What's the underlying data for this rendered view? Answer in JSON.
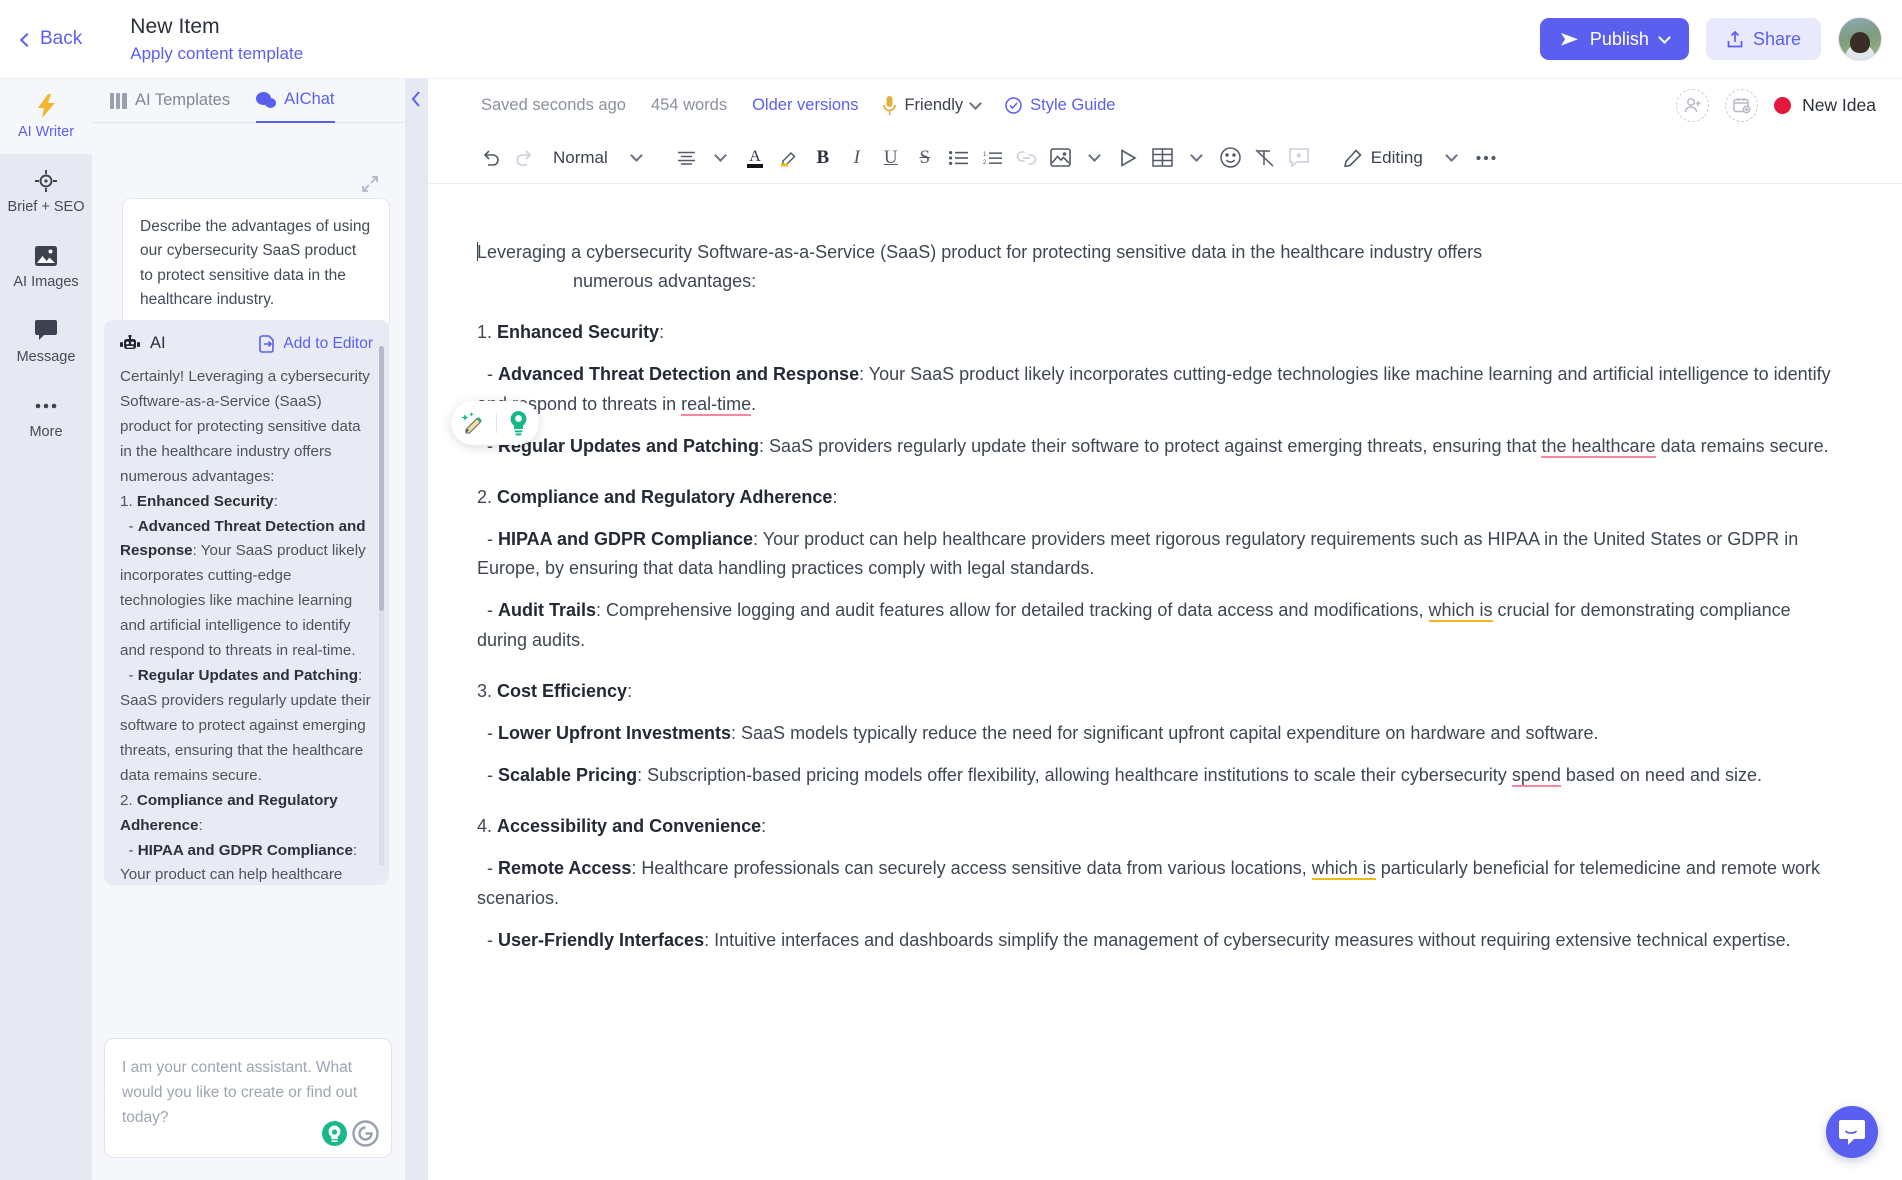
{
  "topbar": {
    "back_label": "Back",
    "doc_title": "New Item",
    "doc_subtitle": "Apply content template",
    "publish_label": "Publish",
    "share_label": "Share"
  },
  "rail": {
    "items": [
      {
        "label": "AI Writer",
        "icon": "lightning-icon",
        "active": true
      },
      {
        "label": "Brief + SEO",
        "icon": "target-icon",
        "active": false
      },
      {
        "label": "AI Images",
        "icon": "image-icon",
        "active": false
      },
      {
        "label": "Message",
        "icon": "chat-icon",
        "active": false
      },
      {
        "label": "More",
        "icon": "ellipsis-icon",
        "active": false
      }
    ]
  },
  "chat": {
    "tabs": [
      {
        "label": "AI Templates",
        "icon": "templates-icon",
        "active": false
      },
      {
        "label": "AIChat",
        "icon": "chat-bubbles-icon",
        "active": true
      }
    ],
    "user_message": "Describe the advantages of using our cybersecurity SaaS product to protect sensitive data in the healthcare industry.",
    "ai_label": "AI",
    "add_to_editor_label": "Add to Editor",
    "ai_response_intro": "Certainly! Leveraging a cybersecurity Software-as-a-Service (SaaS) product for protecting sensitive data in the healthcare industry offers numerous advantages:",
    "ai_response_items": [
      {
        "num": "1. ",
        "heading": "Enhanced Security",
        "tail": ":"
      },
      {
        "dash": "  - ",
        "heading": "Advanced Threat Detection and Response",
        "tail": ": Your SaaS product likely incorporates cutting-edge technologies like machine learning and artificial intelligence to identify and respond to threats in real-time."
      },
      {
        "dash": "  - ",
        "heading": "Regular Updates and Patching",
        "tail": ": SaaS providers regularly update their software to protect against emerging threats, ensuring that the healthcare data remains secure."
      },
      {
        "num": "2. ",
        "heading": "Compliance and Regulatory Adherence",
        "tail": ":"
      },
      {
        "dash": "  - ",
        "heading": "HIPAA and GDPR Compliance",
        "tail": ": Your product can help healthcare providers meet rigorous regulatory requirements such as HIPAA in the United States or GDPR in Europe, by ensuring that data handling practices comply with legal standards."
      }
    ],
    "input_placeholder": "I am your content assistant. What would you like to create or find out today?"
  },
  "editor": {
    "status": {
      "saved": "Saved seconds ago",
      "word_count": "454 words",
      "older_versions": "Older versions",
      "tone": "Friendly",
      "style_guide": "Style Guide",
      "idea_label": "New Idea",
      "idea_color": "#e2183f"
    },
    "toolbar": {
      "undo": "undo-icon",
      "redo": "redo-icon",
      "paragraph_style": "Normal",
      "align": "align-icon",
      "font_color": "font-color-icon",
      "highlight": "highlight-icon",
      "bold": "B",
      "italic": "I",
      "underline": "U",
      "strikethrough": "S",
      "bullet_list": "bullet-list-icon",
      "numbered_list": "numbered-list-icon",
      "link": "link-icon",
      "image": "image-icon",
      "video": "video-icon",
      "table": "table-icon",
      "emoji": "emoji-icon",
      "clear_format": "clear-format-icon",
      "comment": "comment-icon",
      "mode": "Editing",
      "more": "ellipsis-icon"
    },
    "document": {
      "intro_a": "Leveraging a cybersecurity Software-as-a-Service (SaaS) product for protecting sensitive data in the healthcare industry offers",
      "intro_b": "numerous advantages:",
      "sections": [
        {
          "num": "1. ",
          "title": "Enhanced Security",
          "bullets": [
            {
              "label": "Advanced Threat Detection and Response",
              "text_a": ": Your SaaS product likely incorporates cutting-edge technologies like machine learning and artificial intelligence to identify and respond to threats in ",
              "flag": "real-time",
              "flag_type": "red",
              "text_b": "."
            },
            {
              "label": "Regular Updates and Patching",
              "text_a": ": SaaS providers regularly update their software to protect against emerging threats, ensuring that ",
              "flag": "the healthcare",
              "flag_type": "red",
              "text_b": " data remains secure."
            }
          ]
        },
        {
          "num": "2. ",
          "title": "Compliance and Regulatory Adherence",
          "bullets": [
            {
              "label": "HIPAA and GDPR Compliance",
              "text_a": ": Your product can help healthcare providers meet rigorous regulatory requirements such as HIPAA in the United States or GDPR in Europe, by ensuring that data handling practices comply with legal standards.",
              "flag": "",
              "flag_type": "none",
              "text_b": ""
            },
            {
              "label": "Audit Trails",
              "text_a": ": Comprehensive logging and audit features allow for detailed tracking of data access and modifications, ",
              "flag": "which is",
              "flag_type": "yellow",
              "text_b": " crucial for demonstrating compliance during audits."
            }
          ]
        },
        {
          "num": "3. ",
          "title": "Cost Efficiency",
          "bullets": [
            {
              "label": "Lower Upfront Investments",
              "text_a": ": SaaS models typically reduce the need for significant upfront capital expenditure on hardware and software.",
              "flag": "",
              "flag_type": "none",
              "text_b": ""
            },
            {
              "label": "Scalable Pricing",
              "text_a": ": Subscription-based pricing models offer flexibility, allowing healthcare institutions to scale their cybersecurity ",
              "flag": "spend",
              "flag_type": "red",
              "text_b": " based on need and size."
            }
          ]
        },
        {
          "num": "4. ",
          "title": "Accessibility and Convenience",
          "bullets": [
            {
              "label": "Remote Access",
              "text_a": ": Healthcare professionals can securely access sensitive data from various locations, ",
              "flag": "which is",
              "flag_type": "yellow",
              "text_b": " particularly beneficial for telemedicine and remote work scenarios."
            },
            {
              "label": "User-Friendly Interfaces",
              "text_a": ": Intuitive interfaces and dashboards simplify the management of cybersecurity measures without requiring extensive technical expertise.",
              "flag": "",
              "flag_type": "none",
              "text_b": ""
            }
          ]
        }
      ]
    }
  },
  "widgets": {
    "float_tools": [
      "ai-pencil-icon",
      "grammar-bulb-icon"
    ],
    "intercom": "intercom-chat-icon"
  },
  "colors": {
    "accent": "#5b5fef",
    "red_flag": "#f8879f",
    "yellow_flag": "#f0b81c"
  }
}
